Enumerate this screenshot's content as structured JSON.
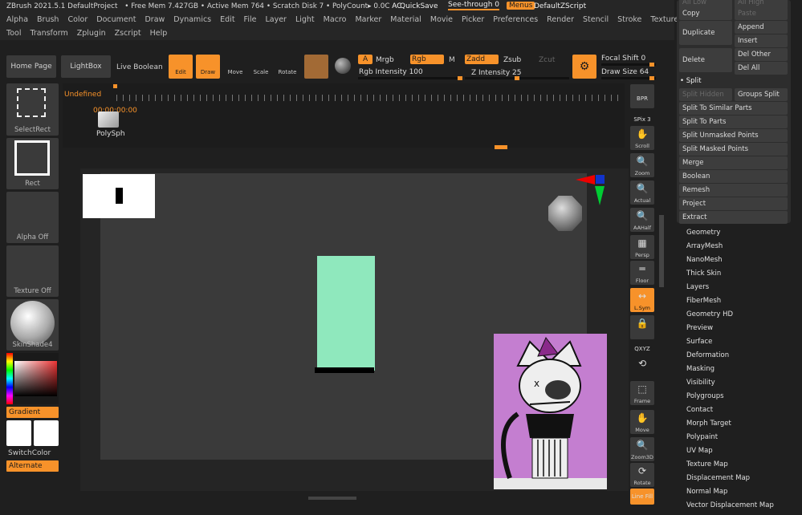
{
  "app": {
    "title": "ZBrush 2021.5.1 DefaultProject",
    "free_mem": "• Free Mem 7.427GB",
    "active_mem": "• Active Mem 764",
    "scratch": "• Scratch Disk 7",
    "polycount": "• PolyCount▸ 0.0C",
    "ac": "AC",
    "quicksave": "QuickSave",
    "see_through": "See-through  0",
    "menus": "Menus",
    "defaultzscript": "DefaultZScript"
  },
  "menu_row1": [
    "Alpha",
    "Brush",
    "Color",
    "Document",
    "Draw",
    "Dynamics",
    "Edit",
    "File",
    "Layer",
    "Light",
    "Macro",
    "Marker",
    "Material",
    "Movie",
    "Picker",
    "Preferences",
    "Render",
    "Stencil",
    "Stroke",
    "Texture"
  ],
  "menu_row2": [
    "Tool",
    "Transform",
    "Zplugin",
    "Zscript",
    "Help"
  ],
  "toolbar": {
    "home": "Home Page",
    "lightbox": "LightBox",
    "live_boolean": "Live Boolean",
    "edit": "Edit",
    "draw": "Draw",
    "move": "Move",
    "scale": "Scale",
    "rotate": "Rotate",
    "a": "A",
    "mrgb": "Mrgb",
    "rgb": "Rgb",
    "m": "M",
    "zadd": "Zadd",
    "zsub": "Zsub",
    "zcut": "Zcut",
    "rgb_intensity": "Rgb Intensity 100",
    "z_intensity": "Z Intensity 25",
    "focal_shift": "Focal Shift 0",
    "draw_size": "Draw Size 64"
  },
  "timeline": {
    "label": "Undefined",
    "time": "00:00:00:00",
    "polysph": "PolySph"
  },
  "left_shelf": {
    "selectrect": "SelectRect",
    "rect": "Rect",
    "alpha": "Alpha Off",
    "texture": "Texture Off",
    "material": "SkinShade4",
    "gradient": "Gradient",
    "switchcolor": "SwitchColor",
    "alternate": "Alternate"
  },
  "right_tools": [
    {
      "icon": "BPR",
      "label": ""
    },
    {
      "icon": "SPix 3",
      "label": ""
    },
    {
      "icon": "✋",
      "label": "Scroll"
    },
    {
      "icon": "🔍",
      "label": "Zoom"
    },
    {
      "icon": "🔍",
      "label": "Actual"
    },
    {
      "icon": "🔍",
      "label": "AAHalf"
    },
    {
      "icon": "▦",
      "label": "Persp"
    },
    {
      "icon": "═",
      "label": "Floor"
    },
    {
      "icon": "↔",
      "label": "L.Sym"
    },
    {
      "icon": "🔒",
      "label": ""
    },
    {
      "icon": "QXYZ",
      "label": ""
    },
    {
      "icon": "⟲",
      "label": ""
    },
    {
      "icon": "⬚",
      "label": "Frame"
    },
    {
      "icon": "✋",
      "label": "Move"
    },
    {
      "icon": "🔍",
      "label": "Zoom3D"
    },
    {
      "icon": "⟳",
      "label": "Rotate"
    },
    {
      "icon": "Line Fill",
      "label": ""
    }
  ],
  "subtool_panel": {
    "all_low": "All Low",
    "all_high": "All High",
    "copy": "Copy",
    "paste": "Paste",
    "duplicate": "Duplicate",
    "append": "Append",
    "insert": "Insert",
    "delete": "Delete",
    "del_other": "Del Other",
    "del_all": "Del All",
    "split_header": "• Split",
    "split_hidden": "Split Hidden",
    "groups_split": "Groups Split",
    "split_similar": "Split To Similar Parts",
    "split_parts": "Split To Parts",
    "split_unmasked": "Split Unmasked Points",
    "split_masked": "Split Masked Points",
    "merge": "Merge",
    "boolean": "Boolean",
    "remesh": "Remesh",
    "project": "Project",
    "extract": "Extract"
  },
  "right_list": [
    "Geometry",
    "ArrayMesh",
    "NanoMesh",
    "Thick Skin",
    "Layers",
    "FiberMesh",
    "Geometry HD",
    "Preview",
    "Surface",
    "Deformation",
    "Masking",
    "Visibility",
    "Polygroups",
    "Contact",
    "Morph Target",
    "Polypaint",
    "UV Map",
    "Texture Map",
    "Displacement Map",
    "Normal Map",
    "Vector Displacement Map"
  ],
  "colors": {
    "accent": "#f7922a",
    "mesh": "#8fe8bd",
    "ref_bg": "#c47ed0"
  }
}
